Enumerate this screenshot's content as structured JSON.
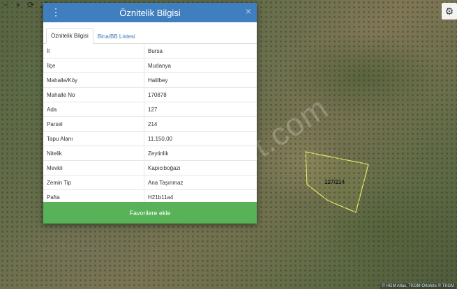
{
  "map": {
    "watermark": "emlakjet.com",
    "parcel_label": "127/214",
    "attribution": "© HGM Atlas, TKGM Ortofoto © TKGM",
    "controls": {
      "zoom_out": "−",
      "zoom_in": "+",
      "refresh": "⟳",
      "fullscreen": "⤢"
    },
    "settings_icon": "gear-icon",
    "parcel_border_color": "#e8e86a"
  },
  "modal": {
    "title": "Öznitelik Bilgisi",
    "menu_icon": "vertical-dots-icon",
    "close_symbol": "×",
    "header_color": "#3f7fbf",
    "tabs": [
      {
        "label": "Öznitelik Bilgisi",
        "active": true
      },
      {
        "label": "Bina/BB Listesi",
        "active": false
      }
    ],
    "rows": [
      {
        "key": "İl",
        "value": "Bursa"
      },
      {
        "key": "İlçe",
        "value": "Mudanya"
      },
      {
        "key": "Mahalle/Köy",
        "value": "Halilbey"
      },
      {
        "key": "Mahalle No",
        "value": "170878"
      },
      {
        "key": "Ada",
        "value": "127"
      },
      {
        "key": "Parsel",
        "value": "214"
      },
      {
        "key": "Tapu Alanı",
        "value": "11.150,00"
      },
      {
        "key": "Nitelik",
        "value": "Zeytinlik"
      },
      {
        "key": "Mevkii",
        "value": "Kapıcıboğazı"
      },
      {
        "key": "Zemin Tip",
        "value": "Ana Taşınmaz"
      },
      {
        "key": "Pafta",
        "value": "H21b11a4"
      }
    ],
    "button_label": "Favorilere ekle",
    "button_color": "#58b258"
  }
}
